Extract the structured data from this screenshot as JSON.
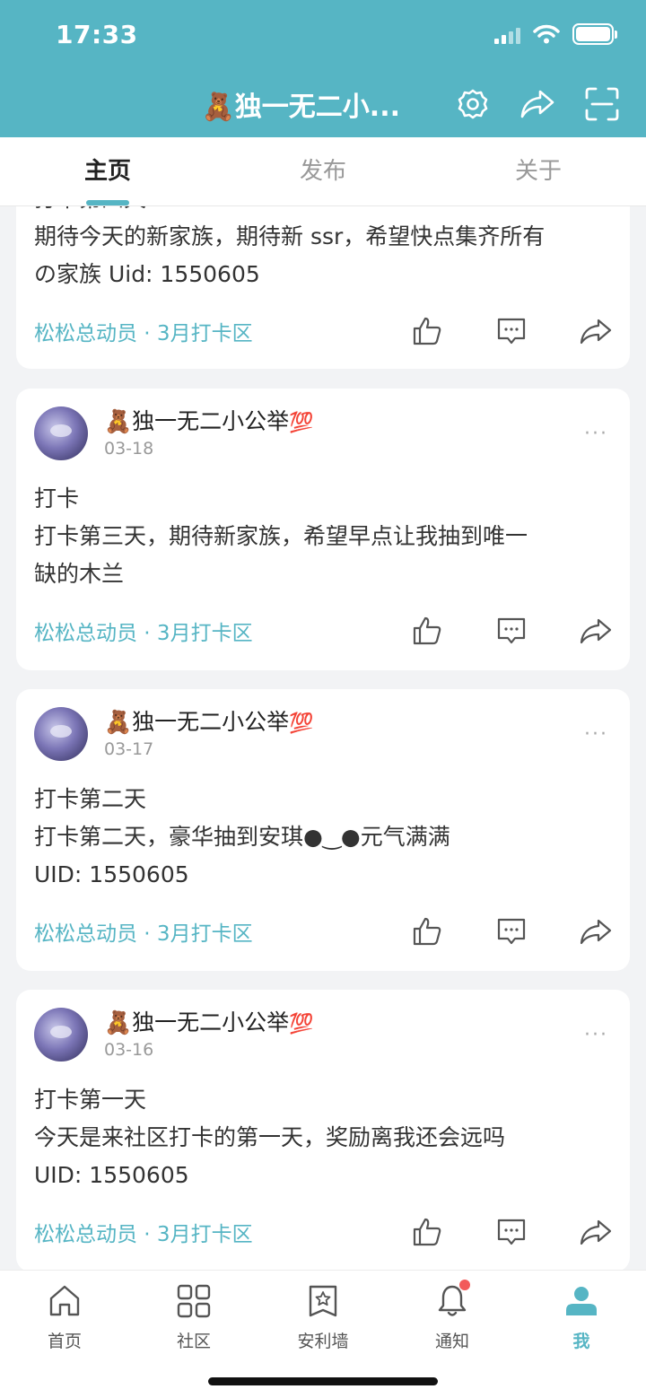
{
  "status_bar": {
    "time": "17:33"
  },
  "header": {
    "title": "🧸独一无二小..."
  },
  "tabs": [
    {
      "label": "主页"
    },
    {
      "label": "发布"
    },
    {
      "label": "关于"
    }
  ],
  "posts": [
    {
      "title": "打卡第四天",
      "body_lines": [
        "期待今天的新家族，期待新 ssr，希望快点集齐所有",
        "の家族 Uid: 1550605"
      ],
      "tags": "松松总动员 · 3月打卡区"
    },
    {
      "author": "🧸独一无二小公举",
      "author_badge": "💯",
      "date": "03-18",
      "title": "打卡",
      "body_lines": [
        "打卡第三天，期待新家族，希望早点让我抽到唯一",
        "缺的木兰"
      ],
      "tags": "松松总动员 · 3月打卡区"
    },
    {
      "author": "🧸独一无二小公举",
      "author_badge": "💯",
      "date": "03-17",
      "title": "打卡第二天",
      "body_lines": [
        "打卡第二天，豪华抽到安琪●‿●元气满满",
        "UID: 1550605"
      ],
      "tags": "松松总动员 · 3月打卡区"
    },
    {
      "author": "🧸独一无二小公举",
      "author_badge": "💯",
      "date": "03-16",
      "title": "打卡第一天",
      "body_lines": [
        "今天是来社区打卡的第一天，奖励离我还会远吗",
        "UID: 1550605"
      ],
      "tags": "松松总动员 · 3月打卡区"
    }
  ],
  "more_label": "···",
  "bottom_nav": [
    {
      "label": "首页",
      "icon": "home-icon"
    },
    {
      "label": "社区",
      "icon": "grid-icon"
    },
    {
      "label": "安利墙",
      "icon": "star-bookmark-icon"
    },
    {
      "label": "通知",
      "icon": "bell-icon"
    },
    {
      "label": "我",
      "icon": "person-icon"
    }
  ],
  "colors": {
    "accent": "#56b5c4",
    "notification_dot": "#f25a5a"
  }
}
